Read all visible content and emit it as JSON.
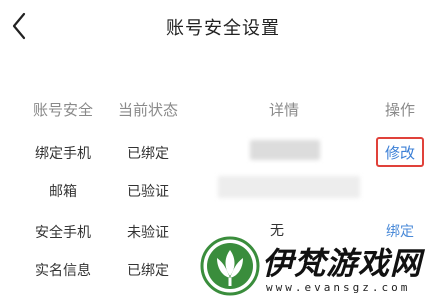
{
  "header": {
    "title": "账号安全设置",
    "back_icon": "chevron-left-icon"
  },
  "table": {
    "columns": [
      "账号安全",
      "当前状态",
      "详情",
      "操作"
    ],
    "rows": [
      {
        "item": "绑定手机",
        "status": "已绑定",
        "action": "修改"
      },
      {
        "item": "邮箱",
        "status": "已验证"
      },
      {
        "item": "安全手机",
        "status": "未验证",
        "detail": "无",
        "action": "绑定"
      },
      {
        "item": "实名信息",
        "status": "已绑定"
      }
    ]
  },
  "watermark": {
    "name": "伊梵游戏网",
    "url": "www.evansgz.com",
    "logo_icon": "lotus-logo-icon",
    "logo_color": "#3a8d3c"
  },
  "colors": {
    "accent_link": "#3b7fd6",
    "highlight_box": "#e0413a",
    "header_text": "#8a8a8a"
  }
}
